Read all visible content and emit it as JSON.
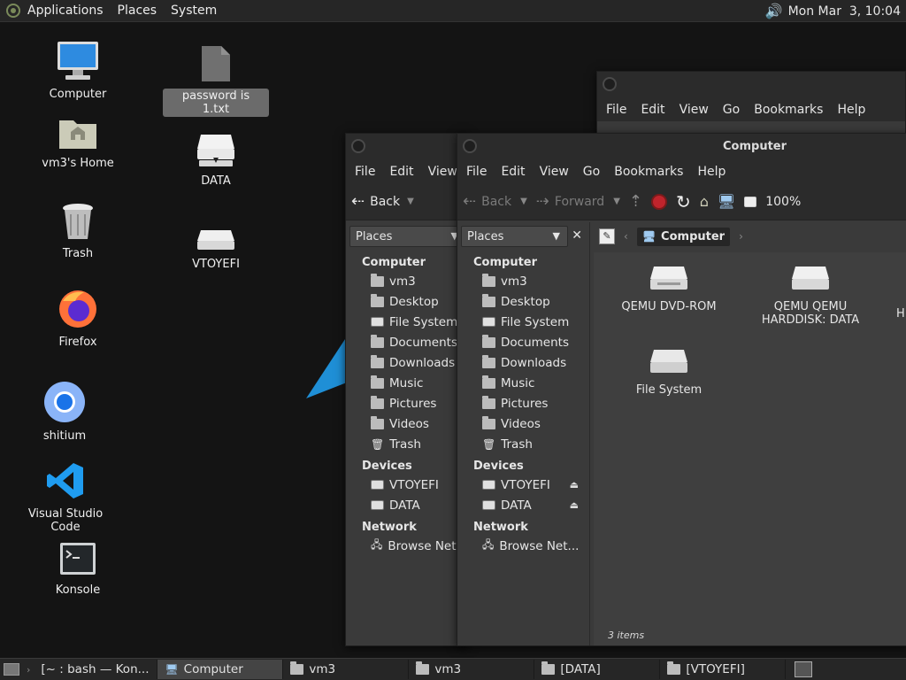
{
  "top_panel": {
    "menus": [
      "Applications",
      "Places",
      "System"
    ],
    "clock": "Mon Mar  3, 10:04"
  },
  "desktop": {
    "icons": [
      {
        "label": "Computer"
      },
      {
        "label": "vm3's Home"
      },
      {
        "label": "Trash"
      },
      {
        "label": "Firefox"
      },
      {
        "label": "shitium"
      },
      {
        "label": "Visual Studio Code"
      },
      {
        "label": "Konsole"
      },
      {
        "label": "password is 1.txt"
      },
      {
        "label": "DATA"
      },
      {
        "label": "VTOYEFI"
      }
    ]
  },
  "window_back": {
    "menus": [
      "File",
      "Edit",
      "View",
      "Go",
      "Bookmarks",
      "Help"
    ]
  },
  "window_mid": {
    "menus": [
      "File",
      "Edit",
      "View"
    ],
    "back": "Back",
    "places_label": "Places",
    "groups": {
      "computer": "Computer",
      "devices": "Devices",
      "network": "Network"
    },
    "items": [
      "vm3",
      "Desktop",
      "File System",
      "Documents",
      "Downloads",
      "Music",
      "Pictures",
      "Videos",
      "Trash"
    ],
    "devices": [
      "VTOYEFI",
      "DATA"
    ],
    "network": [
      "Browse Net..."
    ]
  },
  "window_front": {
    "title": "Computer",
    "menus": [
      "File",
      "Edit",
      "View",
      "Go",
      "Bookmarks",
      "Help"
    ],
    "back": "Back",
    "forward": "Forward",
    "zoom": "100%",
    "places_label": "Places",
    "groups": {
      "computer": "Computer",
      "devices": "Devices",
      "network": "Network"
    },
    "items": [
      "vm3",
      "Desktop",
      "File System",
      "Documents",
      "Downloads",
      "Music",
      "Pictures",
      "Videos",
      "Trash"
    ],
    "devices": [
      "VTOYEFI",
      "DATA"
    ],
    "network": [
      "Browse Net..."
    ],
    "location": "Computer",
    "content_items": [
      {
        "label": "QEMU DVD-ROM"
      },
      {
        "label": "QEMU QEMU HARDDISK: DATA"
      },
      {
        "label": "H"
      },
      {
        "label": "File System"
      }
    ],
    "status": "3 items"
  },
  "taskbar": {
    "tasks": [
      "[~ : bash — Kon...",
      "Computer",
      "vm3",
      "vm3",
      "[DATA]",
      "[VTOYEFI]"
    ]
  }
}
